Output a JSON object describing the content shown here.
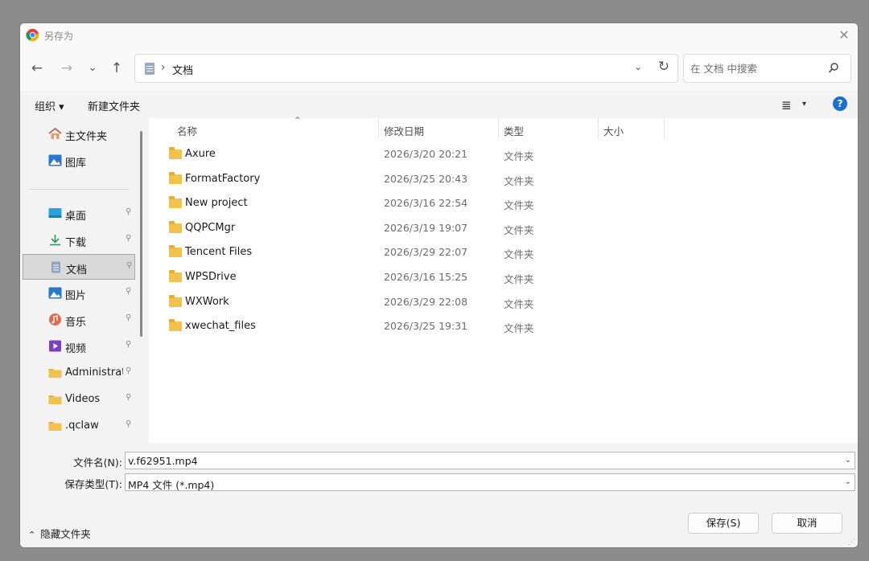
{
  "window": {
    "title": "另存为",
    "close_glyph": "✕",
    "icon": "chrome-icon"
  },
  "nav": {
    "back": "←",
    "forward": "→",
    "recent": "⌄",
    "up": "↑",
    "breadcrumb_sep": "›",
    "current_location": "文档",
    "dropdown": "⌄",
    "refresh": "↻"
  },
  "search": {
    "placeholder": "在 文档 中搜索"
  },
  "toolbar": {
    "organize_label": "组织 ▾",
    "new_folder_label": "新建文件夹",
    "view_glyph": "≣",
    "view_dropdown": "▾",
    "help_glyph": "?"
  },
  "sidebar": {
    "items": [
      {
        "label": "主文件夹",
        "icon": "home-icon",
        "pinned": false
      },
      {
        "label": "图库",
        "icon": "gallery-icon",
        "pinned": false
      },
      {
        "label": "桌面",
        "icon": "desktop-icon",
        "pinned": true
      },
      {
        "label": "下载",
        "icon": "download-icon",
        "pinned": true
      },
      {
        "label": "文档",
        "icon": "document-icon",
        "pinned": true,
        "selected": true
      },
      {
        "label": "图片",
        "icon": "pictures-icon",
        "pinned": true
      },
      {
        "label": "音乐",
        "icon": "music-icon",
        "pinned": true
      },
      {
        "label": "视频",
        "icon": "video-icon",
        "pinned": true
      },
      {
        "label": "Administrat",
        "icon": "folder-icon",
        "pinned": true
      },
      {
        "label": "Videos",
        "icon": "folder-icon",
        "pinned": true
      },
      {
        "label": ".qclaw",
        "icon": "folder-icon",
        "pinned": true
      }
    ],
    "pin_glyph": "📌"
  },
  "file_list": {
    "columns": [
      "名称",
      "修改日期",
      "类型",
      "大小"
    ],
    "sort_glyph": "^",
    "rows": [
      {
        "name": "Axure",
        "date": "2026/3/20 20:21",
        "type": "文件夹"
      },
      {
        "name": "FormatFactory",
        "date": "2026/3/25 20:43",
        "type": "文件夹"
      },
      {
        "name": "New project",
        "date": "2026/3/16 22:54",
        "type": "文件夹"
      },
      {
        "name": "QQPCMgr",
        "date": "2026/3/19 19:07",
        "type": "文件夹"
      },
      {
        "name": "Tencent Files",
        "date": "2026/3/29 22:07",
        "type": "文件夹"
      },
      {
        "name": "WPSDrive",
        "date": "2026/3/16 15:25",
        "type": "文件夹"
      },
      {
        "name": "WXWork",
        "date": "2026/3/29 22:08",
        "type": "文件夹"
      },
      {
        "name": "xwechat_files",
        "date": "2026/3/25 19:31",
        "type": "文件夹"
      }
    ]
  },
  "form": {
    "filename_label": "文件名(N):",
    "filename_value": "v.f62951.mp4",
    "filetype_label": "保存类型(T):",
    "filetype_value": "MP4 文件 (*.mp4)",
    "dropdown_glyph": "⌄",
    "hide_folders_caret": "⌃",
    "hide_folders_label": "隐藏文件夹",
    "save_label": "保存(S)",
    "cancel_label": "取消"
  },
  "colors": {
    "folder": "#f3c24b",
    "help": "#1b6fd3",
    "selected_bg": "#d9d9d9"
  }
}
